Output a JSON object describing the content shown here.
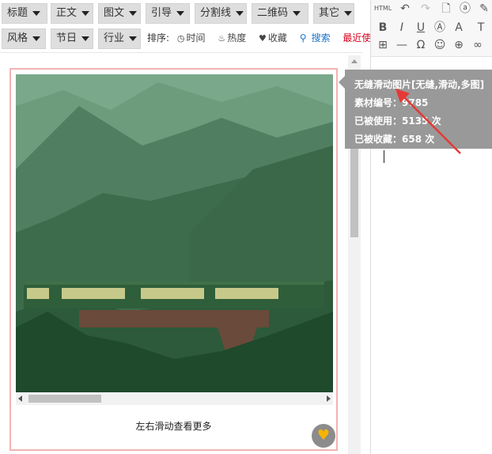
{
  "categories_row1": [
    "标题",
    "正文",
    "图文",
    "引导",
    "分割线",
    "二维码",
    "其它"
  ],
  "categories_row2": [
    "风格",
    "节日",
    "行业"
  ],
  "sort": {
    "label": "排序:",
    "time": "时间",
    "heat": "热度",
    "favorite": "收藏",
    "search": "搜索",
    "recent": "最近使用"
  },
  "template": {
    "caption": "左右滑动查看更多"
  },
  "tooltip": {
    "title": "无缝滑动图片[无缝,滑动,多图]",
    "material_id": "素材编号：9785",
    "used": "已被使用：5135 次",
    "favorited": "已被收藏：658 次"
  },
  "editor": {
    "html_label": "HTML",
    "icons": [
      "html-icon",
      "undo-icon",
      "redo-icon",
      "new-document-icon",
      "find-replace-icon",
      "eraser-icon",
      "bold-icon",
      "italic-icon",
      "underline-icon",
      "font-border-icon",
      "font-color-icon",
      "text-size-icon",
      "table-icon",
      "horizontal-rule-icon",
      "special-char-icon",
      "emoticon-icon",
      "search-replace-icon",
      "link-icon"
    ]
  },
  "colors": {
    "accent_red": "#d9001b",
    "search_blue": "#1a73c8",
    "card_border": "#f2b3b3",
    "tooltip_bg": "#999999",
    "favorite_gold": "#f5b400"
  }
}
